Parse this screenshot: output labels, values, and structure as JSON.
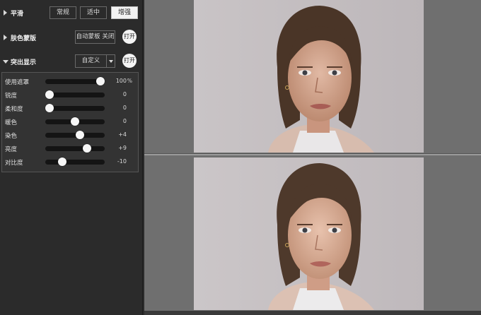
{
  "smooth": {
    "title": "平滑",
    "options": [
      "常规",
      "适中",
      "增强"
    ],
    "active_index": 2
  },
  "skin_mask": {
    "title": "肤色蒙版",
    "auto_label": "自动蒙板 关闭",
    "open_label": "打开"
  },
  "highlight": {
    "title": "突出显示",
    "preset_value": "自定义",
    "open_label": "打开",
    "sliders": [
      {
        "label": "使用遮罩",
        "value": "100",
        "unit": "%",
        "position": 1.0
      },
      {
        "label": "锐度",
        "value": "0",
        "unit": "",
        "position": 0.0
      },
      {
        "label": "柔和度",
        "value": "0",
        "unit": "",
        "position": 0.0
      },
      {
        "label": "暖色",
        "value": "0",
        "unit": "",
        "position": 0.5
      },
      {
        "label": "染色",
        "value": "+4",
        "unit": "",
        "position": 0.6
      },
      {
        "label": "亮度",
        "value": "+9",
        "unit": "",
        "position": 0.73
      },
      {
        "label": "对比度",
        "value": "-10",
        "unit": "",
        "position": 0.25
      }
    ]
  },
  "colors": {
    "panel_bg": "#2b2b2b",
    "canvas_bg": "#7a7a7a",
    "slider_track": "#141414",
    "slider_thumb": "#f7f7f7"
  }
}
